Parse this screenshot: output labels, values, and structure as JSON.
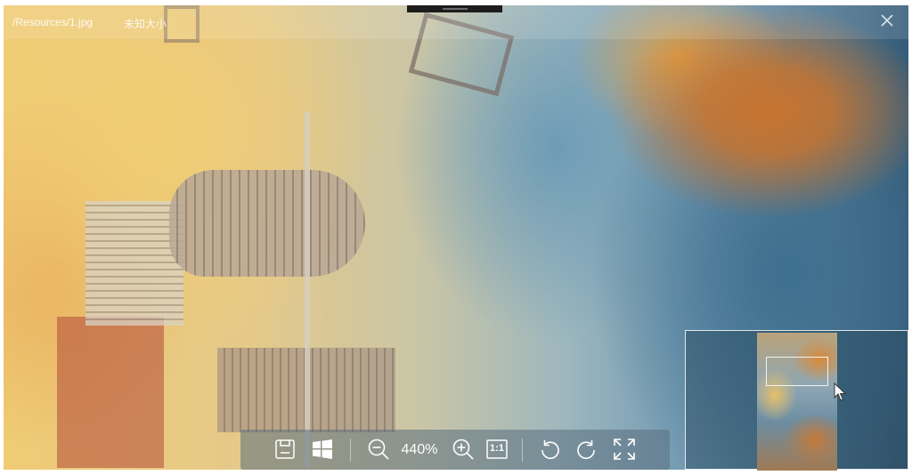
{
  "app": {
    "file_path": "/Resources/1.jpg",
    "file_size": "未知大小"
  },
  "toolbar": {
    "zoom_level": "440%",
    "actual_size_label": "1:1",
    "buttons": [
      {
        "name": "save",
        "icon": "save-icon"
      },
      {
        "name": "set-wallpaper",
        "icon": "windows-icon"
      },
      {
        "name": "zoom-out",
        "icon": "zoom-out-icon"
      },
      {
        "name": "zoom-in",
        "icon": "zoom-in-icon"
      },
      {
        "name": "actual-size",
        "icon": "actual-size-icon"
      },
      {
        "name": "rotate-left",
        "icon": "rotate-left-icon"
      },
      {
        "name": "rotate-right",
        "icon": "rotate-right-icon"
      },
      {
        "name": "fullscreen",
        "icon": "fullscreen-icon"
      }
    ]
  },
  "window": {
    "close_icon": "close-icon"
  },
  "colors": {
    "toolbar_bg": "#5a6e7d",
    "icon_color": "#ffffff"
  }
}
